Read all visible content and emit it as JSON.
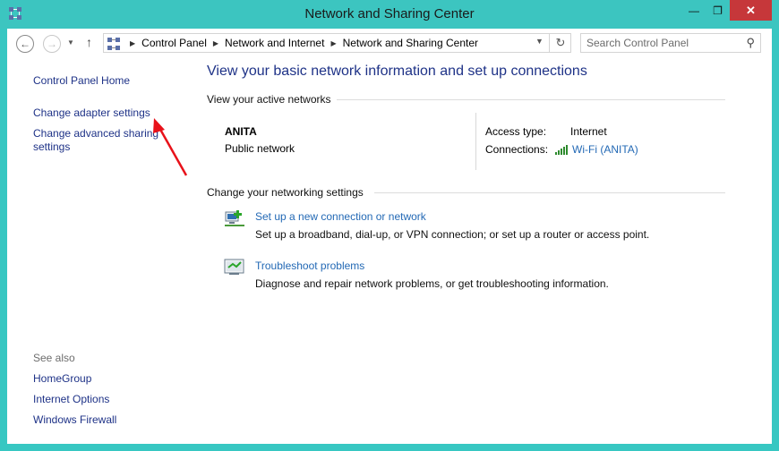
{
  "window": {
    "title": "Network and Sharing Center",
    "minimize": "—",
    "maximize": "❐",
    "close": "✕"
  },
  "nav": {
    "back": "←",
    "forward": "→",
    "recent": "▼",
    "up": "↑",
    "breadcrumbs": [
      "Control Panel",
      "Network and Internet",
      "Network and Sharing Center"
    ],
    "breadcrumb_sep": "▶",
    "dropdown": "▼",
    "refresh": "↻",
    "search_placeholder": "Search Control Panel",
    "search_icon": "⚲"
  },
  "left_pane": {
    "home": "Control Panel Home",
    "change_adapter": "Change adapter settings",
    "change_advanced": "Change advanced sharing settings",
    "see_also_label": "See also",
    "see_also": [
      "HomeGroup",
      "Internet Options",
      "Windows Firewall"
    ]
  },
  "main": {
    "heading": "View your basic network information and set up connections",
    "active_networks_label": "View your active networks",
    "network": {
      "name": "ANITA",
      "type": "Public network",
      "access_type_label": "Access type:",
      "access_type_value": "Internet",
      "connections_label": "Connections:",
      "connection_value": "Wi-Fi (ANITA)"
    },
    "change_settings_label": "Change your networking settings",
    "tasks": [
      {
        "link": "Set up a new connection or network",
        "desc": "Set up a broadband, dial-up, or VPN connection; or set up a router or access point.",
        "icon": "new-connection-icon"
      },
      {
        "link": "Troubleshoot problems",
        "desc": "Diagnose and repair network problems, or get troubleshooting information.",
        "icon": "troubleshoot-icon"
      }
    ]
  },
  "colors": {
    "titlebar": "#3CC5C0",
    "close_button": "#C6373A",
    "link_dark": "#1E3287",
    "link_blue": "#2369B5",
    "annotation_arrow": "#E8121A"
  }
}
